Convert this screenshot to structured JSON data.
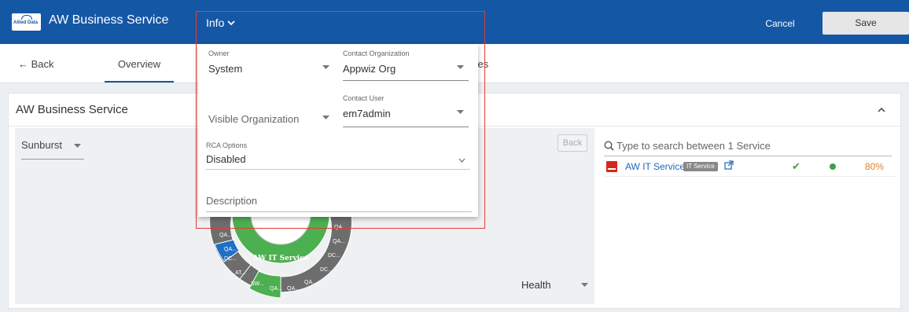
{
  "header": {
    "logo_text": "Allied Data",
    "app_title": "AW Business Service",
    "info_label": "Info",
    "cancel_label": "Cancel",
    "save_label": "Save"
  },
  "tabs": {
    "back_label": "← Back",
    "overview_label": "Overview",
    "hidden_tab_tail": "ures"
  },
  "card": {
    "title": "AW Business Service",
    "view_select": "Sunburst",
    "back_button": "Back",
    "health_select": "Health",
    "sunburst_center": "AW IT Service",
    "sunburst_labels": [
      "QA...",
      "QA...",
      "QA...",
      "QA...",
      "DC...",
      "DC...",
      "DC...",
      "AT...",
      "SW...",
      "QA...",
      "QA...",
      "QA...",
      "QA..."
    ]
  },
  "service_list": {
    "search_placeholder": "Type to search between 1 Service",
    "rows": [
      {
        "name": "AW IT Service",
        "badge": "IT Service",
        "availability": "80%"
      }
    ]
  },
  "popup": {
    "owner_label": "Owner",
    "owner_value": "System",
    "contact_org_label": "Contact Organization",
    "contact_org_value": "Appwiz Org",
    "visible_org_placeholder": "Visible Organization",
    "contact_user_label": "Contact User",
    "contact_user_value": "em7admin",
    "rca_label": "RCA Options",
    "rca_value": "Disabled",
    "description_placeholder": "Description"
  },
  "colors": {
    "header_bg": "#1457a5",
    "link": "#1f65b8",
    "health_green": "#3aa04b",
    "warning_orange": "#e57c24",
    "highlight_red": "#e53935"
  }
}
